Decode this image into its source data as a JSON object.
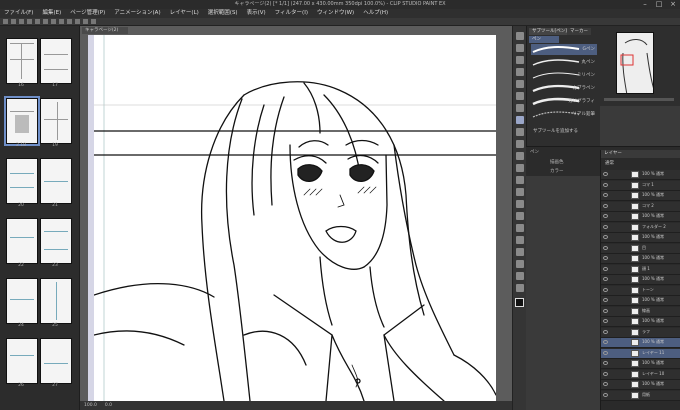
{
  "title": "キャラページ(2) [* 1/1] (247.00 x 430.00mm 350dpi 100.0%) - CLIP STUDIO PAINT EX",
  "window_controls": [
    "–",
    "□",
    "×"
  ],
  "menu": [
    "ファイル(F)",
    "編集(E)",
    "ページ管理(P)",
    "アニメーション(A)",
    "レイヤー(L)",
    "選択範囲(S)",
    "表示(V)",
    "フィルター(I)",
    "ウィンドウ(W)",
    "ヘルプ(H)"
  ],
  "canvas_tab": "キャラページ(2)",
  "pages": [
    {
      "left": "16",
      "right": "17"
    },
    {
      "left": "2 18",
      "right": "19"
    },
    {
      "left": "20",
      "right": "21"
    },
    {
      "left": "22",
      "right": "23"
    },
    {
      "left": "24",
      "right": "25"
    },
    {
      "left": "26",
      "right": "27"
    }
  ],
  "status": {
    "zoom": "100.0",
    "angle": "0.0"
  },
  "brush_panel": {
    "tabs": [
      "サブツール[ペン]",
      "マーカー"
    ],
    "active_tab": "ペン",
    "brushes": [
      "Gペン",
      "丸ペン",
      "ミリペン",
      "カブラペン",
      "カリグラフィ",
      "リアル鉛筆"
    ],
    "footer": "サブツールを追加する"
  },
  "property": {
    "title": "ペン",
    "label1": "描画色",
    "label2": "カラー"
  },
  "layer_panel": {
    "header": "レイヤー",
    "blend": "通常",
    "layers": [
      {
        "name": "100 % 通常",
        "selected": false
      },
      {
        "name": "コマ 1",
        "selected": false
      },
      {
        "name": "100 % 通常",
        "selected": false
      },
      {
        "name": "コマ 2",
        "selected": false
      },
      {
        "name": "100 % 通常",
        "selected": false
      },
      {
        "name": "フォルダー 2",
        "selected": false
      },
      {
        "name": "100 % 通常",
        "selected": false
      },
      {
        "name": "目",
        "selected": false
      },
      {
        "name": "100 % 通常",
        "selected": false
      },
      {
        "name": "顔 1",
        "selected": false
      },
      {
        "name": "100 % 通常",
        "selected": false
      },
      {
        "name": "トーン",
        "selected": false
      },
      {
        "name": "100 % 通常",
        "selected": false
      },
      {
        "name": "線画",
        "selected": false
      },
      {
        "name": "100 % 通常",
        "selected": false
      },
      {
        "name": "ラフ",
        "selected": false
      },
      {
        "name": "100 % 通常",
        "selected": true
      },
      {
        "name": "レイヤー 11",
        "selected": true
      },
      {
        "name": "100 % 通常",
        "selected": false
      },
      {
        "name": "レイヤー 10",
        "selected": false
      },
      {
        "name": "100 % 通常",
        "selected": false
      },
      {
        "name": "用紙",
        "selected": false
      }
    ]
  },
  "colors": {
    "accent": "#6f8fc8",
    "selection": "#4d5e80",
    "ruler": "#d6d6e6"
  }
}
